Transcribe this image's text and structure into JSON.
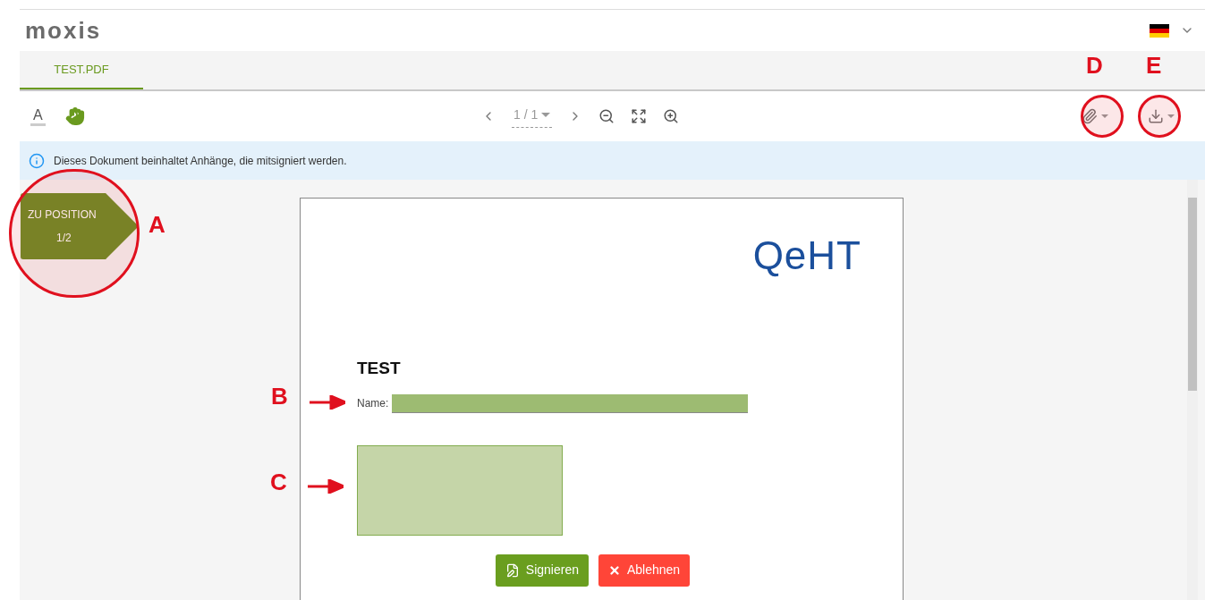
{
  "header": {
    "logo": "moxis"
  },
  "tabs": [
    {
      "label": "TEST.PDF",
      "selected": true
    }
  ],
  "toolbar": {
    "text_tool": "A",
    "page_indicator": "1 / 1"
  },
  "info_banner": {
    "text": "Dieses Dokument beinhaltet Anhänge, die mitsigniert werden."
  },
  "position_button": {
    "label": "ZU POSITION",
    "counter": "1/2"
  },
  "document": {
    "logo": "QeHT",
    "heading": "TEST",
    "name_label": "Name:"
  },
  "actions": [
    {
      "label": "Signieren",
      "kind": "sign"
    },
    {
      "label": "Ablehnen",
      "kind": "reject"
    }
  ],
  "annotations": [
    {
      "letter": "A",
      "kind": "circle"
    },
    {
      "letter": "B",
      "kind": "arrow"
    },
    {
      "letter": "C",
      "kind": "arrow"
    },
    {
      "letter": "D",
      "kind": "circle"
    },
    {
      "letter": "E",
      "kind": "circle"
    }
  ]
}
